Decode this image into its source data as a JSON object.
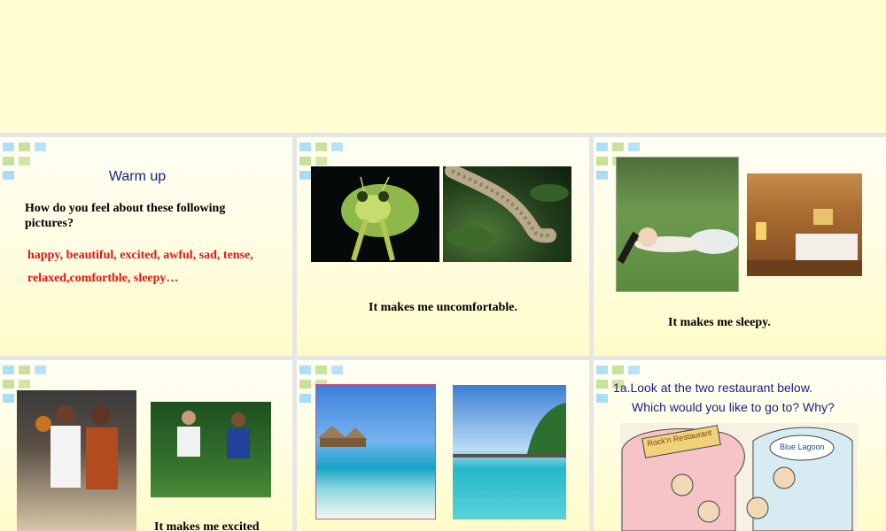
{
  "slides": {
    "warmup": {
      "title": "Warm up",
      "question": "How do you feel about these following pictures?",
      "words_line1": "happy, beautiful,  excited, awful, sad, tense,",
      "words_line2": "relaxed,comfortble, sleepy…"
    },
    "uncomfortable": {
      "caption": "It makes me uncomfortable."
    },
    "sleepy": {
      "caption": "It makes me sleepy."
    },
    "excited": {
      "caption": "It makes me excited"
    },
    "restaurant": {
      "line1": "1a.Look at the two restaurant below.",
      "line2": "Which would you like to go to? Why?",
      "sign_left": "Rock'n Restaurant",
      "sign_right": "Blue Lagoon"
    }
  },
  "colors": {
    "slide_background": "#fffde0",
    "title_blue": "#1c1c86",
    "word_red": "#e41313",
    "top_area": "#fffed2"
  }
}
